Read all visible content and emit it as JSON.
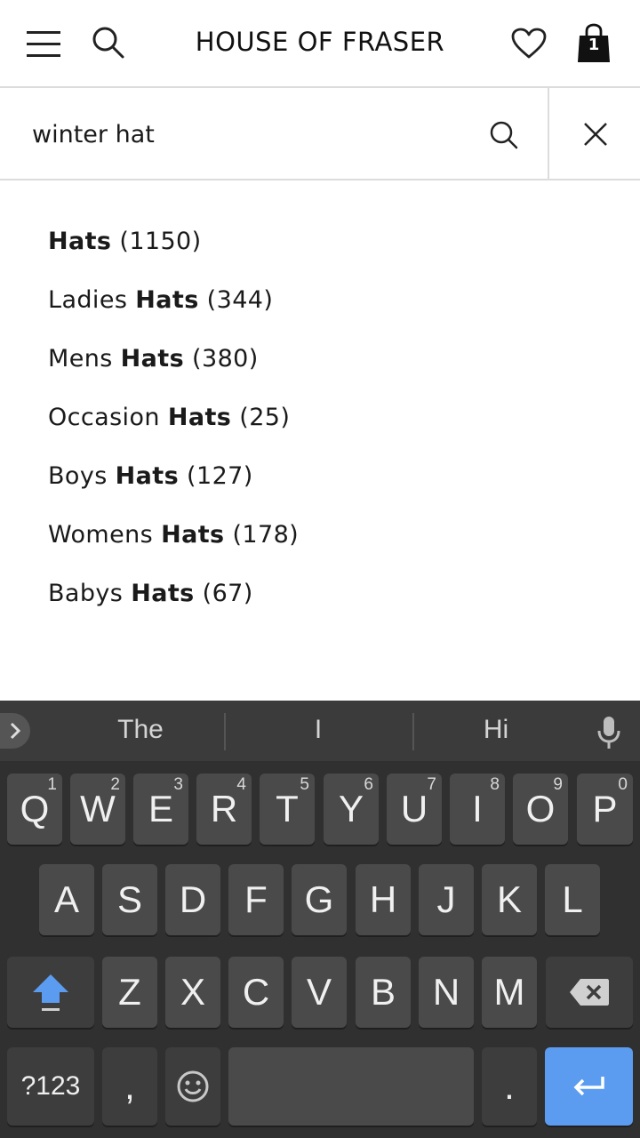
{
  "header": {
    "brand": "HOUSE OF FRASER",
    "bag_count": "1"
  },
  "search": {
    "value": "winter hat",
    "placeholder": ""
  },
  "suggestions": [
    {
      "prefix": "",
      "bold": "Hats",
      "count": " (1150)"
    },
    {
      "prefix": "Ladies ",
      "bold": "Hats",
      "count": " (344)"
    },
    {
      "prefix": "Mens ",
      "bold": "Hats",
      "count": " (380)"
    },
    {
      "prefix": "Occasion ",
      "bold": "Hats",
      "count": " (25)"
    },
    {
      "prefix": "Boys ",
      "bold": "Hats",
      "count": " (127)"
    },
    {
      "prefix": "Womens ",
      "bold": "Hats",
      "count": " (178)"
    },
    {
      "prefix": "Babys ",
      "bold": "Hats",
      "count": " (67)"
    }
  ],
  "keyboard": {
    "suggestions": [
      "The",
      "I",
      "Hi"
    ],
    "row1": [
      {
        "k": "Q",
        "h": "1"
      },
      {
        "k": "W",
        "h": "2"
      },
      {
        "k": "E",
        "h": "3"
      },
      {
        "k": "R",
        "h": "4"
      },
      {
        "k": "T",
        "h": "5"
      },
      {
        "k": "Y",
        "h": "6"
      },
      {
        "k": "U",
        "h": "7"
      },
      {
        "k": "I",
        "h": "8"
      },
      {
        "k": "O",
        "h": "9"
      },
      {
        "k": "P",
        "h": "0"
      }
    ],
    "row2": [
      "A",
      "S",
      "D",
      "F",
      "G",
      "H",
      "J",
      "K",
      "L"
    ],
    "row3": [
      "Z",
      "X",
      "C",
      "V",
      "B",
      "N",
      "M"
    ],
    "symbols_label": "?123",
    "comma": ",",
    "period": "."
  },
  "colors": {
    "keyboard_bg": "#303030",
    "key_bg": "#4a4a4a",
    "enter_key": "#5b9cf0",
    "shift_arrow": "#5b9cf0"
  }
}
